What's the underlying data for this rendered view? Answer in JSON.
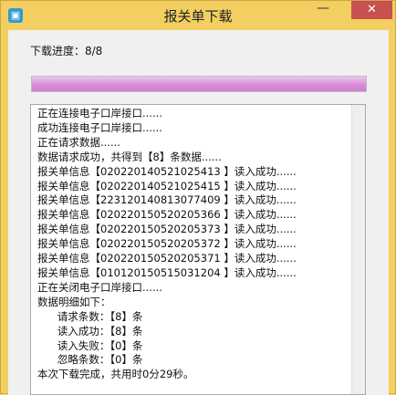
{
  "window": {
    "title": "报关单下载",
    "minimize_glyph": "—",
    "close_glyph": "✕",
    "icon": "app-icon"
  },
  "progress": {
    "label": "下载进度：8/8",
    "fraction": 1.0
  },
  "log": {
    "lines": [
      "正在连接电子口岸接口......",
      "成功连接电子口岸接口......",
      "正在请求数据......",
      "数据请求成功，共得到【8】条数据......",
      "报关单信息【020220140521025413 】读入成功......",
      "报关单信息【020220140521025415 】读入成功......",
      "报关单信息【223120140813077409 】读入成功......",
      "报关单信息【020220150520205366 】读入成功......",
      "报关单信息【020220150520205373 】读入成功......",
      "报关单信息【020220150520205372 】读入成功......",
      "报关单信息【020220150520205371 】读入成功......",
      "报关单信息【010120150515031204 】读入成功......",
      "正在关闭电子口岸接口......",
      "数据明细如下：",
      "      请求条数：【8】条",
      "      读入成功：【8】条",
      "      读入失败：【0】条",
      "      忽略条数：【0】条",
      "本次下载完成，共用时0分29秒。"
    ]
  }
}
